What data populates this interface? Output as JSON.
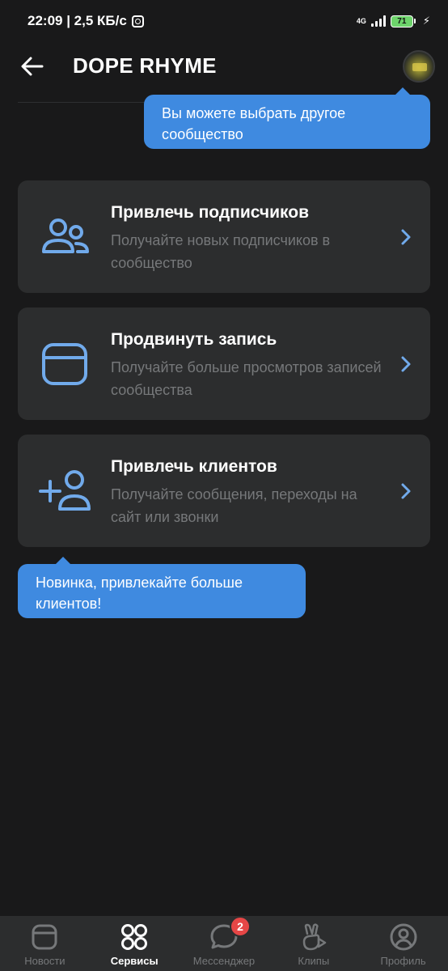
{
  "status_bar": {
    "time_and_speed": "22:09 | 2,5 КБ/с",
    "network": "4G",
    "battery": "71"
  },
  "header": {
    "title": "DOPE RHYME"
  },
  "tooltips": {
    "community_switch": "Вы можете выбрать другое сообщество",
    "new_feature": "Новинка, привлекайте больше клиентов!"
  },
  "cards": [
    {
      "title": "Привлечь подписчиков",
      "subtitle": "Получайте новых подписчиков в сообщество",
      "icon": "users-icon"
    },
    {
      "title": "Продвинуть запись",
      "subtitle": "Получайте больше просмотров записей сообщества",
      "icon": "post-icon"
    },
    {
      "title": "Привлечь клиентов",
      "subtitle": "Получайте сообщения, переходы на сайт или звонки",
      "icon": "add-user-icon"
    }
  ],
  "tabbar": {
    "tabs": [
      {
        "label": "Новости",
        "icon": "news-icon"
      },
      {
        "label": "Сервисы",
        "icon": "services-icon",
        "active": true
      },
      {
        "label": "Мессенджер",
        "icon": "messenger-icon",
        "badge": "2"
      },
      {
        "label": "Клипы",
        "icon": "clips-icon"
      },
      {
        "label": "Профиль",
        "icon": "profile-icon"
      }
    ]
  },
  "colors": {
    "background": "#19191a",
    "card": "#2c2d2e",
    "accent": "#3f8ae0",
    "icon_blue": "#71aaeb",
    "badge": "#e64646"
  }
}
